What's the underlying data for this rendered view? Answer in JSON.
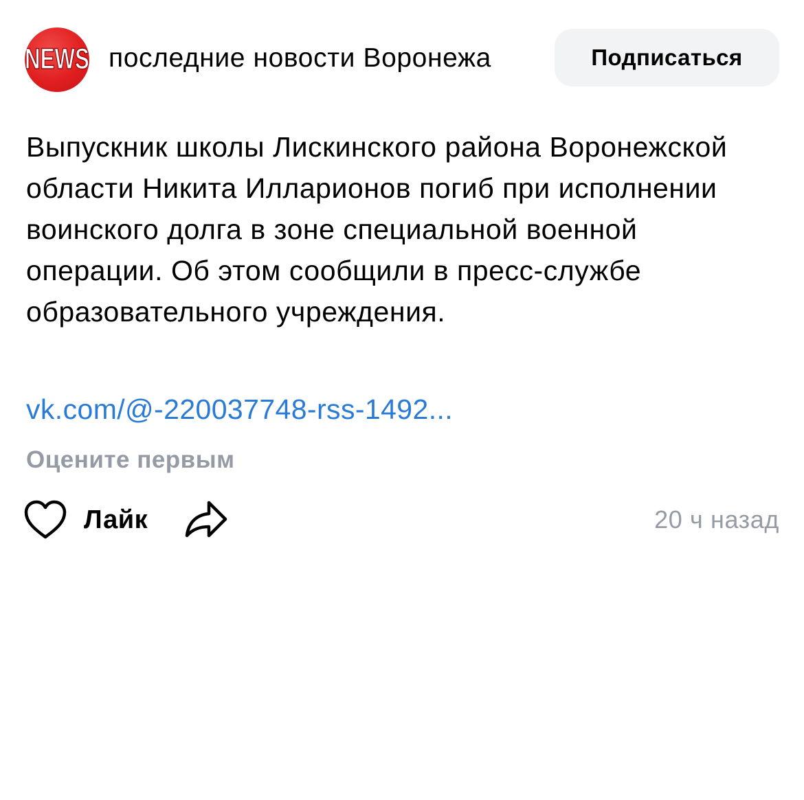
{
  "group": {
    "name": "последние новости Воронежа",
    "avatar_icon": "news-logo-icon",
    "avatar_logo_text": "NEWS",
    "avatar_color": "#e11f1f"
  },
  "subscribe": {
    "label": "Подписаться"
  },
  "post": {
    "text": "Выпускник школы Лискинского района Воронежской области Никита Илларионов погиб при исполнении воинского долга в зоне специальной военной операции. Об этом сообщили в пресс-службе образовательного учреждения.",
    "link": "vk.com/@-220037748-rss-1492...",
    "link_color": "#2a7bd5",
    "rate_prompt": "Оцените первым"
  },
  "actions": {
    "like_label": "Лайк",
    "like_icon": "heart-icon",
    "share_icon": "share-arrow-icon",
    "timestamp": "20 ч назад"
  },
  "colors": {
    "secondary_text": "#949ba5",
    "button_bg": "#f2f3f5"
  }
}
